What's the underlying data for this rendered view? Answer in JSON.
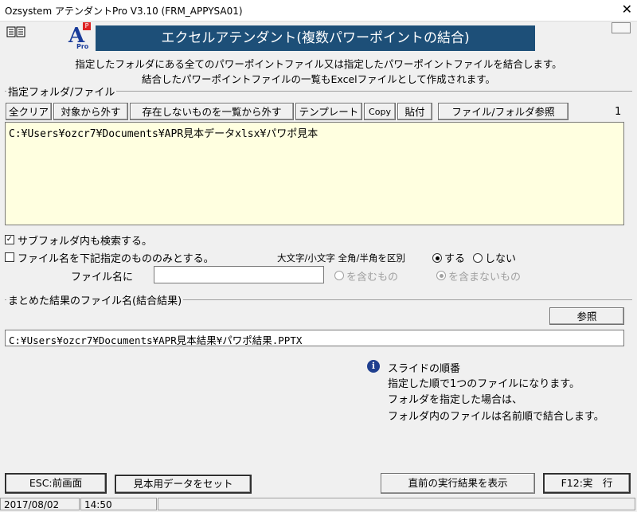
{
  "window": {
    "title": "Ozsystem アテンダントPro V3.10 (FRM_APPYSA01)",
    "close_glyph": "✕",
    "minimize_glyph": "▭"
  },
  "header": {
    "logo_letter": "A",
    "logo_corner": "P",
    "logo_sub": "Pro",
    "banner_title": "エクセルアテンダント(複数パワーポイントの結合)",
    "desc_line1": "指定したフォルダにある全てのパワーポイントファイル又は指定したパワーポイントファイルを結合します。",
    "desc_line2": "結合したパワーポイントファイルの一覧もExcelファイルとして作成されます。"
  },
  "source_group": {
    "label": "指定フォルダ/ファイル",
    "count": "1",
    "toolbar": {
      "clear_all": "全クリア",
      "remove": "対象から外す",
      "remove_missing": "存在しないものを一覧から外す",
      "template": "テンプレート",
      "copy": "Copy",
      "paste": "貼付",
      "browse": "ファイル/フォルダ参照"
    },
    "list_text": "C:¥Users¥ozcr7¥Documents¥APR見本データxlsx¥パワポ見本"
  },
  "options": {
    "subfolder_label": "サブフォルダ内も検索する。",
    "subfolder_checked": true,
    "check_mark": "✓",
    "filename_only_label": "ファイル名を下記指定のもののみとする。",
    "filename_only_checked": false,
    "case_label": "大文字/小文字 全角/半角を区別",
    "case_yes": "する",
    "case_no": "しない",
    "filename_label": "ファイル名に",
    "filename_value": "",
    "contains": "を含むもの",
    "not_contains": "を含まないもの"
  },
  "output_group": {
    "label": "まとめた結果のファイル名(結合結果)",
    "browse": "参照",
    "path": "C:¥Users¥ozcr7¥Documents¥APR見本結果¥パワポ結果.PPTX"
  },
  "info": {
    "icon": "i",
    "line1": "スライドの順番",
    "line2": "指定した順で1つのファイルになります。",
    "line3": "フォルダを指定した場合は、",
    "line4": "フォルダ内のファイルは名前順で結合します。"
  },
  "footer": {
    "back": "ESC:前画面",
    "sample": "見本用データをセット",
    "show_result": "直前の実行結果を表示",
    "run": "F12:実　行"
  },
  "statusbar": {
    "date": "2017/08/02",
    "time": "14:50"
  }
}
